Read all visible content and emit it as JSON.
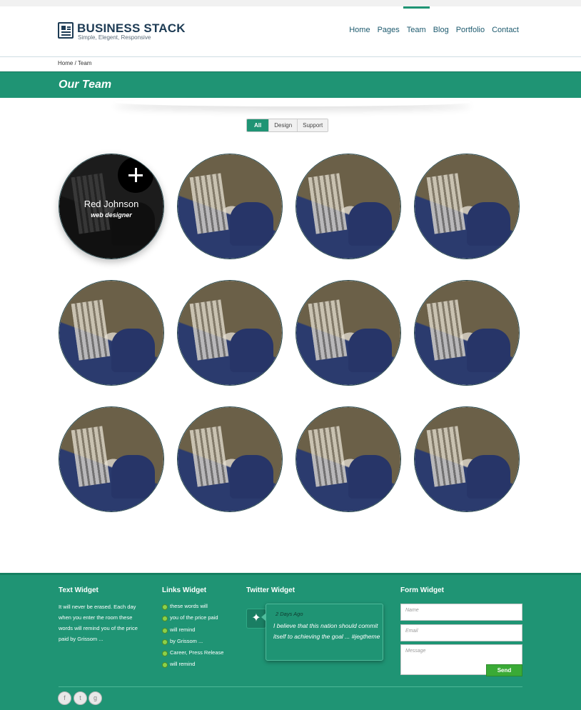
{
  "header": {
    "logo_title": "BUSINESS STACK",
    "logo_tagline": "Simple, Elegent, Responsive",
    "nav": [
      "Home",
      "Pages",
      "Team",
      "Blog",
      "Portfolio",
      "Contact"
    ],
    "active_nav": "Team"
  },
  "breadcrumb": {
    "home": "Home",
    "separator": "/",
    "current": "Team"
  },
  "page_title": "Our Team",
  "filters": {
    "all": "All",
    "design": "Design",
    "support": "Support",
    "active": "All"
  },
  "team": {
    "featured": {
      "name": "Red Johnson",
      "role": "web designer"
    },
    "member_count": 12
  },
  "footer": {
    "text_widget": {
      "title": "Text Widget",
      "body": "It will never be erased. Each day when you enter the room these words will remind you of the price paid by Grissom ..."
    },
    "links_widget": {
      "title": "Links Widget",
      "items": [
        "these words will",
        "you of the price paid",
        "will remind",
        "by Grissom ...",
        "Career, Press Release",
        "will remind"
      ]
    },
    "twitter_widget": {
      "title": "Twitter Widget",
      "date": "2 Days Ago",
      "text": "I believe that this nation should commit itself to achieving the goal ... #jegtheme"
    },
    "form_widget": {
      "title": "Form Widget",
      "name_placeholder": "Name",
      "email_placeholder": "Email",
      "message_placeholder": "Message",
      "send_label": "Send"
    },
    "social": [
      "f",
      "t",
      "g"
    ]
  },
  "colors": {
    "brand_green": "#1f9474",
    "navy": "#1d3b54",
    "send_green": "#3aaa36"
  }
}
